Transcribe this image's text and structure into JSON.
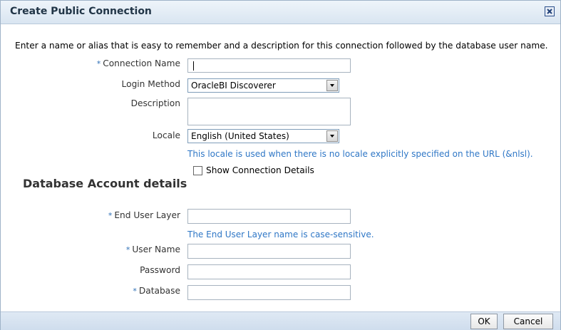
{
  "dialog": {
    "title": "Create Public Connection",
    "close_icon": "close-icon"
  },
  "intro": "Enter a name or alias that is easy to remember and a description for this connection followed by the database user name.",
  "form": {
    "required_marker": "*",
    "connection_name": {
      "label": "Connection Name",
      "value": ""
    },
    "login_method": {
      "label": "Login Method",
      "selected": "OracleBI Discoverer"
    },
    "description": {
      "label": "Description",
      "value": ""
    },
    "locale": {
      "label": "Locale",
      "selected": "English (United States)",
      "hint": "This locale is used when there is no locale explicitly specified on the URL (&nlsl)."
    },
    "show_connection_details": {
      "label": "Show Connection Details",
      "checked": false
    }
  },
  "database_account": {
    "heading": "Database Account details",
    "end_user_layer": {
      "label": "End User Layer",
      "value": "",
      "hint": "The End User Layer name is case-sensitive."
    },
    "user_name": {
      "label": "User Name",
      "value": ""
    },
    "password": {
      "label": "Password",
      "value": ""
    },
    "database": {
      "label": "Database",
      "value": ""
    }
  },
  "footer": {
    "ok_label": "OK",
    "cancel_label": "Cancel"
  },
  "colors": {
    "title_bar": "#dce8f4",
    "hint_text": "#2f77c6",
    "required_marker": "#2d6fb6"
  }
}
